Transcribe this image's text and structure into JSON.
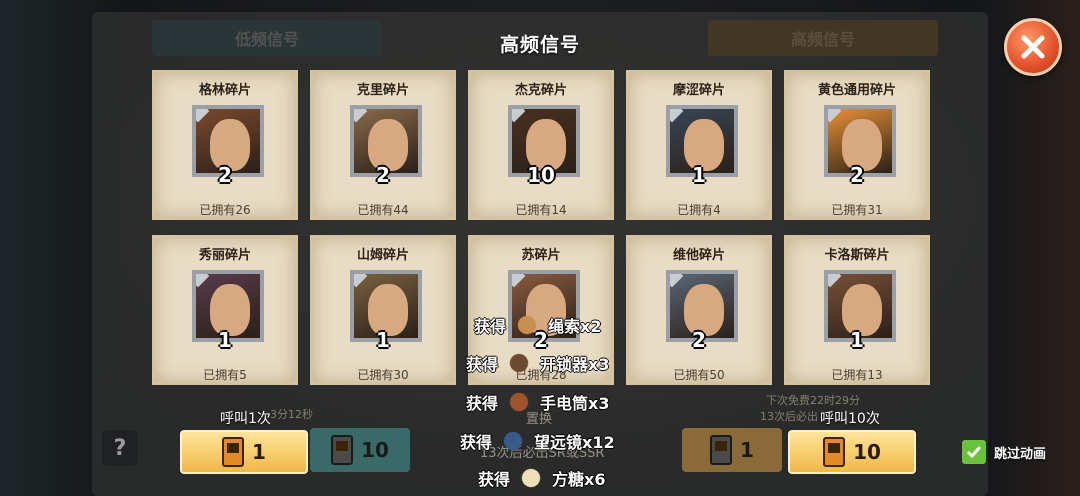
{
  "background": {
    "tab_low": "低频信号",
    "tab_high": "高频信号",
    "replace_label": "置换",
    "timer_left": "3分12秒",
    "next_free": "下次免费22时29分",
    "guarantee_right": "13次后必出",
    "guarantee_center": "13次后必出SR或SSR"
  },
  "dialog": {
    "title": "高频信号",
    "close_icon": "close-icon"
  },
  "cards": [
    {
      "name": "格林碎片",
      "count": "2",
      "owned": "已拥有26",
      "color": "#7a4a30"
    },
    {
      "name": "克里碎片",
      "count": "2",
      "owned": "已拥有44",
      "color": "#8a6a4a"
    },
    {
      "name": "杰克碎片",
      "count": "10",
      "owned": "已拥有14",
      "color": "#4a3020"
    },
    {
      "name": "摩涩碎片",
      "count": "1",
      "owned": "已拥有4",
      "color": "#3a4656"
    },
    {
      "name": "黄色通用碎片",
      "count": "2",
      "owned": "已拥有31",
      "color": "#e89038"
    },
    {
      "name": "秀丽碎片",
      "count": "1",
      "owned": "已拥有5",
      "color": "#5a3a4a"
    },
    {
      "name": "山姆碎片",
      "count": "1",
      "owned": "已拥有30",
      "color": "#7a6040"
    },
    {
      "name": "苏碎片",
      "count": "2",
      "owned": "已拥有28",
      "color": "#8a5a40"
    },
    {
      "name": "维他碎片",
      "count": "2",
      "owned": "已拥有50",
      "color": "#5a6676"
    },
    {
      "name": "卡洛斯碎片",
      "count": "1",
      "owned": "已拥有13",
      "color": "#7a5038"
    }
  ],
  "call_once": {
    "label": "呼叫1次",
    "cost": "1",
    "bg_cost": "10"
  },
  "call_ten": {
    "label": "呼叫10次",
    "cost": "10",
    "bg_cost": "1"
  },
  "rewards": [
    {
      "prefix": "获得",
      "item": "绳索x2",
      "icon": "rope-icon"
    },
    {
      "prefix": "获得",
      "item": "开锁器x3",
      "icon": "lockpick-icon"
    },
    {
      "prefix": "获得",
      "item": "手电筒x3",
      "icon": "flashlight-icon"
    },
    {
      "prefix": "获得",
      "item": "望远镜x12",
      "icon": "binoculars-icon"
    },
    {
      "prefix": "获得",
      "item": "方糖x6",
      "icon": "sugar-cube-icon"
    }
  ],
  "skip_animation": {
    "label": "跳过动画",
    "checked": true
  },
  "help": "?"
}
